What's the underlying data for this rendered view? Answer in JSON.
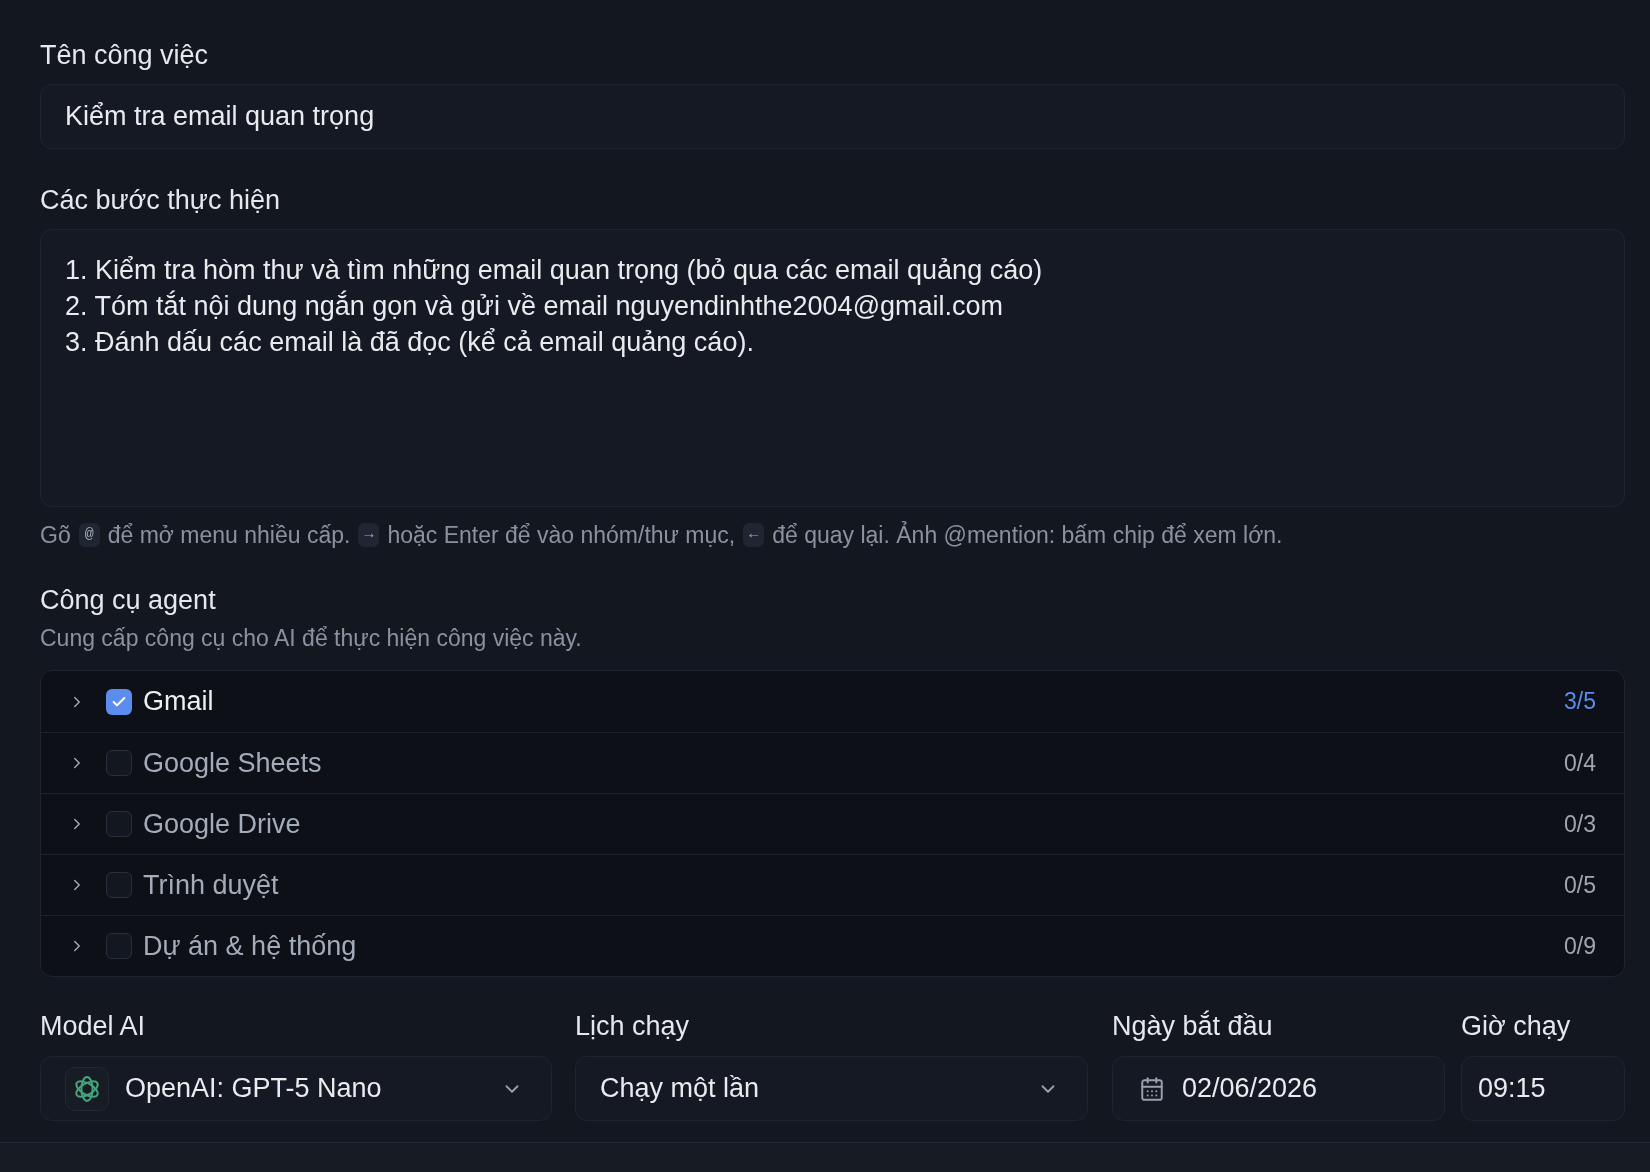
{
  "task_name": {
    "label": "Tên công việc",
    "value": "Kiểm tra email quan trọng"
  },
  "steps": {
    "label": "Các bước thực hiện",
    "lines": [
      "1. Kiểm tra hòm thư và tìm những email quan trọng (bỏ qua các email quảng cáo)",
      "2. Tóm tắt nội dung ngắn gọn và gửi về email nguyendinhthe2004@gmail.com",
      "3. Đánh dấu các email là đã đọc (kể cả email quảng cáo)."
    ]
  },
  "hint": [
    {
      "kind": "text",
      "text": "Gõ"
    },
    {
      "kind": "key",
      "text": "@"
    },
    {
      "kind": "text",
      "text": "để mở menu nhiều cấp."
    },
    {
      "kind": "key",
      "text": "→"
    },
    {
      "kind": "text",
      "text": "hoặc Enter để vào nhóm/thư mục,"
    },
    {
      "kind": "key",
      "text": "←"
    },
    {
      "kind": "text",
      "text": "để quay lại. Ảnh @mention: bấm chip để xem lớn."
    }
  ],
  "tools": {
    "title": "Công cụ agent",
    "description": "Cung cấp công cụ cho AI để thực hiện công việc này.",
    "items": [
      {
        "name": "Gmail",
        "checked": true,
        "expanded": false,
        "count": "3/5"
      },
      {
        "name": "Google Sheets",
        "checked": false,
        "expanded": false,
        "count": "0/4"
      },
      {
        "name": "Google Drive",
        "checked": false,
        "expanded": false,
        "count": "0/3"
      },
      {
        "name": "Trình duyệt",
        "checked": false,
        "expanded": false,
        "count": "0/5"
      },
      {
        "name": "Dự án & hệ thống",
        "checked": false,
        "expanded": false,
        "count": "0/9"
      }
    ]
  },
  "settings": [
    {
      "kind": "model",
      "label": "Model AI",
      "value": "OpenAI: GPT-5 Nano"
    },
    {
      "kind": "select",
      "label": "Lịch chạy",
      "value": "Chạy một lần"
    },
    {
      "kind": "date",
      "label": "Ngày bắt đầu",
      "value": "02/06/2026"
    },
    {
      "kind": "time",
      "label": "Giờ chạy",
      "value": "09:15"
    }
  ]
}
